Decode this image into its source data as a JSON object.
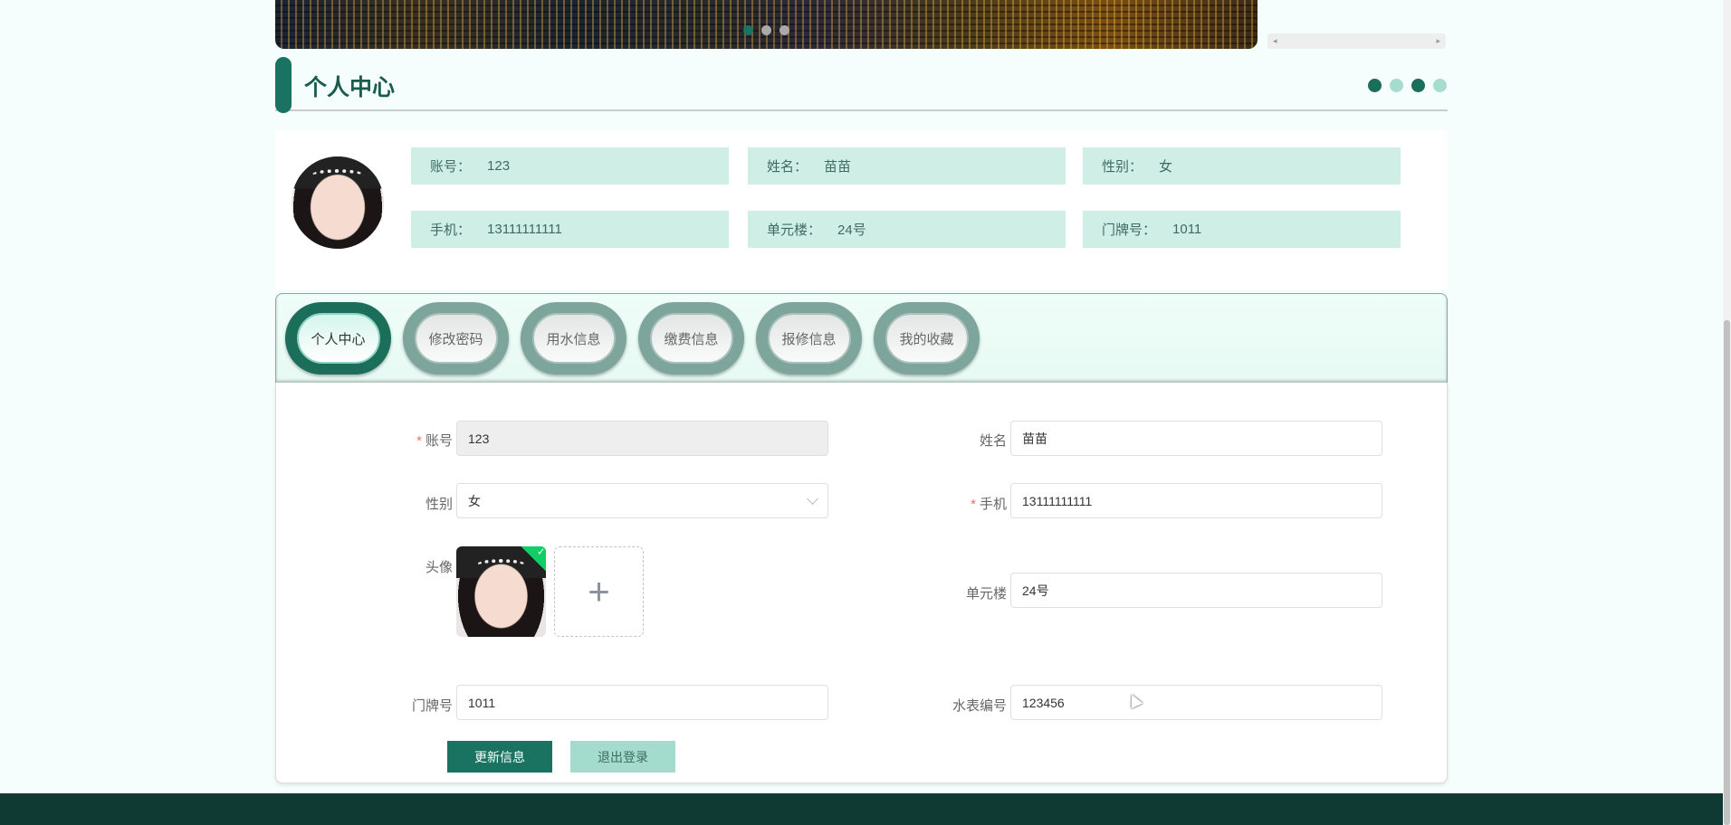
{
  "section_title": "个人中心",
  "info": [
    {
      "label": "账号：",
      "value": "123"
    },
    {
      "label": "姓名：",
      "value": "苗苗"
    },
    {
      "label": "性别：",
      "value": "女"
    },
    {
      "label": "手机：",
      "value": "13111111111"
    },
    {
      "label": "单元楼：",
      "value": "24号"
    },
    {
      "label": "门牌号：",
      "value": "1011"
    }
  ],
  "tabs": [
    "个人中心",
    "修改密码",
    "用水信息",
    "缴费信息",
    "报修信息",
    "我的收藏"
  ],
  "form": {
    "required_mark": "*",
    "account": {
      "label": "账号",
      "value": "123"
    },
    "name": {
      "label": "姓名",
      "value": "苗苗"
    },
    "gender": {
      "label": "性别",
      "value": "女"
    },
    "phone": {
      "label": "手机",
      "value": "13111111111"
    },
    "avatar": {
      "label": "头像",
      "add": "+"
    },
    "building": {
      "label": "单元楼",
      "value": "24号"
    },
    "door": {
      "label": "门牌号",
      "value": "1011"
    },
    "meter": {
      "label": "水表编号",
      "value": "123456"
    }
  },
  "buttons": {
    "update": "更新信息",
    "logout": "退出登录"
  },
  "colors": {
    "primary": "#1a7360",
    "light": "#cfeee6",
    "footer": "#0f3a33"
  }
}
